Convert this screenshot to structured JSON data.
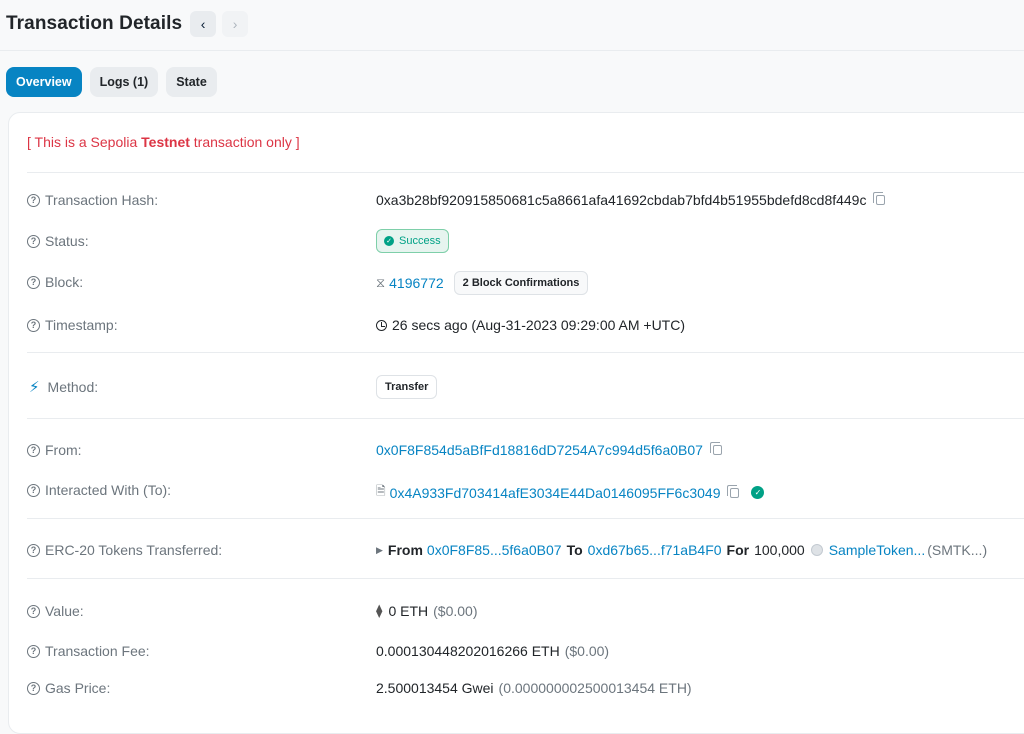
{
  "header": {
    "title": "Transaction Details",
    "prev_icon": "chevron-left-icon",
    "next_icon": "chevron-right-icon"
  },
  "tabs": [
    {
      "label": "Overview",
      "active": true
    },
    {
      "label": "Logs (1)",
      "active": false
    },
    {
      "label": "State",
      "active": false
    }
  ],
  "notice": {
    "prefix": "[ This is a Sepolia ",
    "strong": "Testnet",
    "suffix": " transaction only ]"
  },
  "rows": {
    "tx_hash": {
      "label": "Transaction Hash:",
      "value": "0xa3b28bf920915850681c5a8661afa41692cbdab7bfd4b51955bdefd8cd8f449c"
    },
    "status": {
      "label": "Status:",
      "value": "Success"
    },
    "block": {
      "label": "Block:",
      "value": "4196772",
      "confirmations": "2 Block Confirmations"
    },
    "timestamp": {
      "label": "Timestamp:",
      "value": "26 secs ago (Aug-31-2023 09:29:00 AM +UTC)"
    },
    "method": {
      "label": "Method:",
      "value": "Transfer"
    },
    "from": {
      "label": "From:",
      "value": "0x0F8F854d5aBfFd18816dD7254A7c994d5f6a0B07"
    },
    "to": {
      "label": "Interacted With (To):",
      "value": "0x4A933Fd703414afE3034E44Da0146095FF6c3049"
    },
    "erc20": {
      "label": "ERC-20 Tokens Transferred:",
      "from_word": "From",
      "from_addr": "0x0F8F85...5f6a0B07",
      "to_word": "To",
      "to_addr": "0xd67b65...f71aB4F0",
      "for_word": "For",
      "amount": "100,000",
      "token_name": "SampleToken...",
      "token_symbol": "(SMTK...)"
    },
    "value": {
      "label": "Value:",
      "amount": "0 ETH",
      "usd": "($0.00)"
    },
    "fee": {
      "label": "Transaction Fee:",
      "amount": "0.000130448202016266 ETH",
      "usd": "($0.00)"
    },
    "gas_price": {
      "label": "Gas Price:",
      "amount": "2.500013454 Gwei",
      "eth": "(0.000000002500013454 ETH)"
    }
  },
  "colors": {
    "accent": "#0784c3",
    "success": "#00a186",
    "danger": "#dc3545",
    "muted": "#6c757d"
  }
}
